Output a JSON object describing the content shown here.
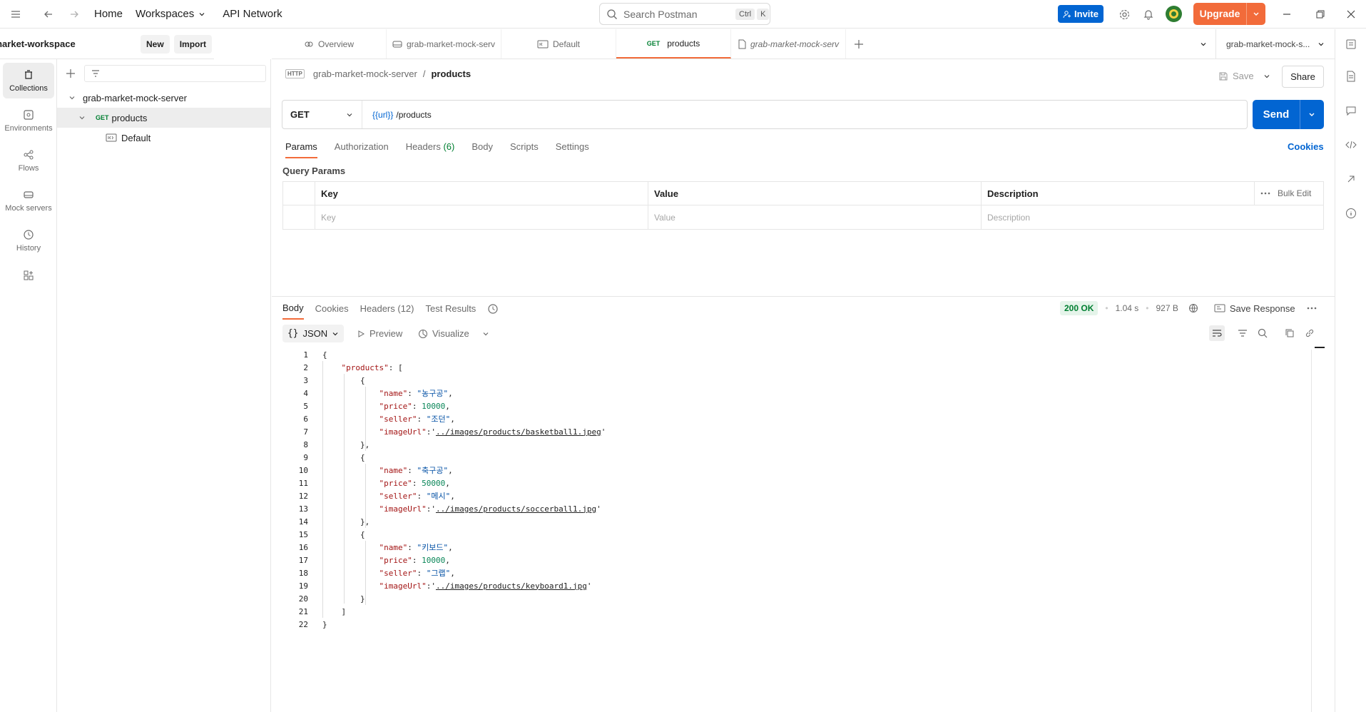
{
  "topbar": {
    "home": "Home",
    "workspaces": "Workspaces",
    "api_network": "API Network",
    "search_placeholder": "Search Postman",
    "shortcut_ctrl": "Ctrl",
    "shortcut_k": "K",
    "invite": "Invite",
    "upgrade": "Upgrade"
  },
  "rail": {
    "collections": "Collections",
    "environments": "Environments",
    "flows": "Flows",
    "mock_servers": "Mock servers",
    "history": "History"
  },
  "workspace": {
    "name": "grab-market-workspace",
    "new": "New",
    "import": "Import"
  },
  "tree": {
    "collection": "grab-market-mock-server",
    "request_method": "GET",
    "request": "products",
    "example": "Default"
  },
  "tabs": [
    {
      "label": "Overview"
    },
    {
      "label": "grab-market-mock-serv"
    },
    {
      "label": "Default"
    },
    {
      "method": "GET",
      "label": "products"
    },
    {
      "label": "grab-market-mock-serv"
    }
  ],
  "environment": "grab-market-mock-s...",
  "breadcrumb": {
    "collection": "grab-market-mock-server",
    "separator": "/",
    "request": "products",
    "save": "Save",
    "share": "Share"
  },
  "request": {
    "method": "GET",
    "url_var": "{{url}}",
    "url_path": "/products",
    "send": "Send"
  },
  "req_tabs": {
    "params": "Params",
    "authorization": "Authorization",
    "headers": "Headers",
    "headers_count": "(6)",
    "body": "Body",
    "scripts": "Scripts",
    "settings": "Settings",
    "cookies": "Cookies"
  },
  "query_params": {
    "title": "Query Params",
    "col_key": "Key",
    "col_value": "Value",
    "col_description": "Description",
    "bulk_edit": "Bulk Edit",
    "ph_key": "Key",
    "ph_value": "Value",
    "ph_description": "Description"
  },
  "response": {
    "tab_body": "Body",
    "tab_cookies": "Cookies",
    "tab_headers": "Headers",
    "headers_count": "(12)",
    "tab_tests": "Test Results",
    "status": "200 OK",
    "time": "1.04 s",
    "size": "927 B",
    "save_response": "Save Response",
    "format": "JSON",
    "preview": "Preview",
    "visualize": "Visualize"
  },
  "code_lines": [
    "{",
    "    \"products\": [",
    "        {",
    "            \"name\": \"농구공\",",
    "            \"price\": 10000,",
    "            \"seller\": \"조던\",",
    "            \"imageUrl\":'../images/products/basketball1.jpeg'",
    "        },",
    "        {",
    "            \"name\": \"축구공\",",
    "            \"price\": 50000,",
    "            \"seller\": \"메시\",",
    "            \"imageUrl\":'../images/products/soccerball1.jpg'",
    "        },",
    "        {",
    "            \"name\": \"키보드\",",
    "            \"price\": 10000,",
    "            \"seller\": \"그랩\",",
    "            \"imageUrl\":'../images/products/keyboard1.jpg'",
    "        }",
    "    ]",
    "}"
  ],
  "colors": {
    "accent": "#f26b3a",
    "primary": "#0265d2",
    "success": "#007f31"
  }
}
